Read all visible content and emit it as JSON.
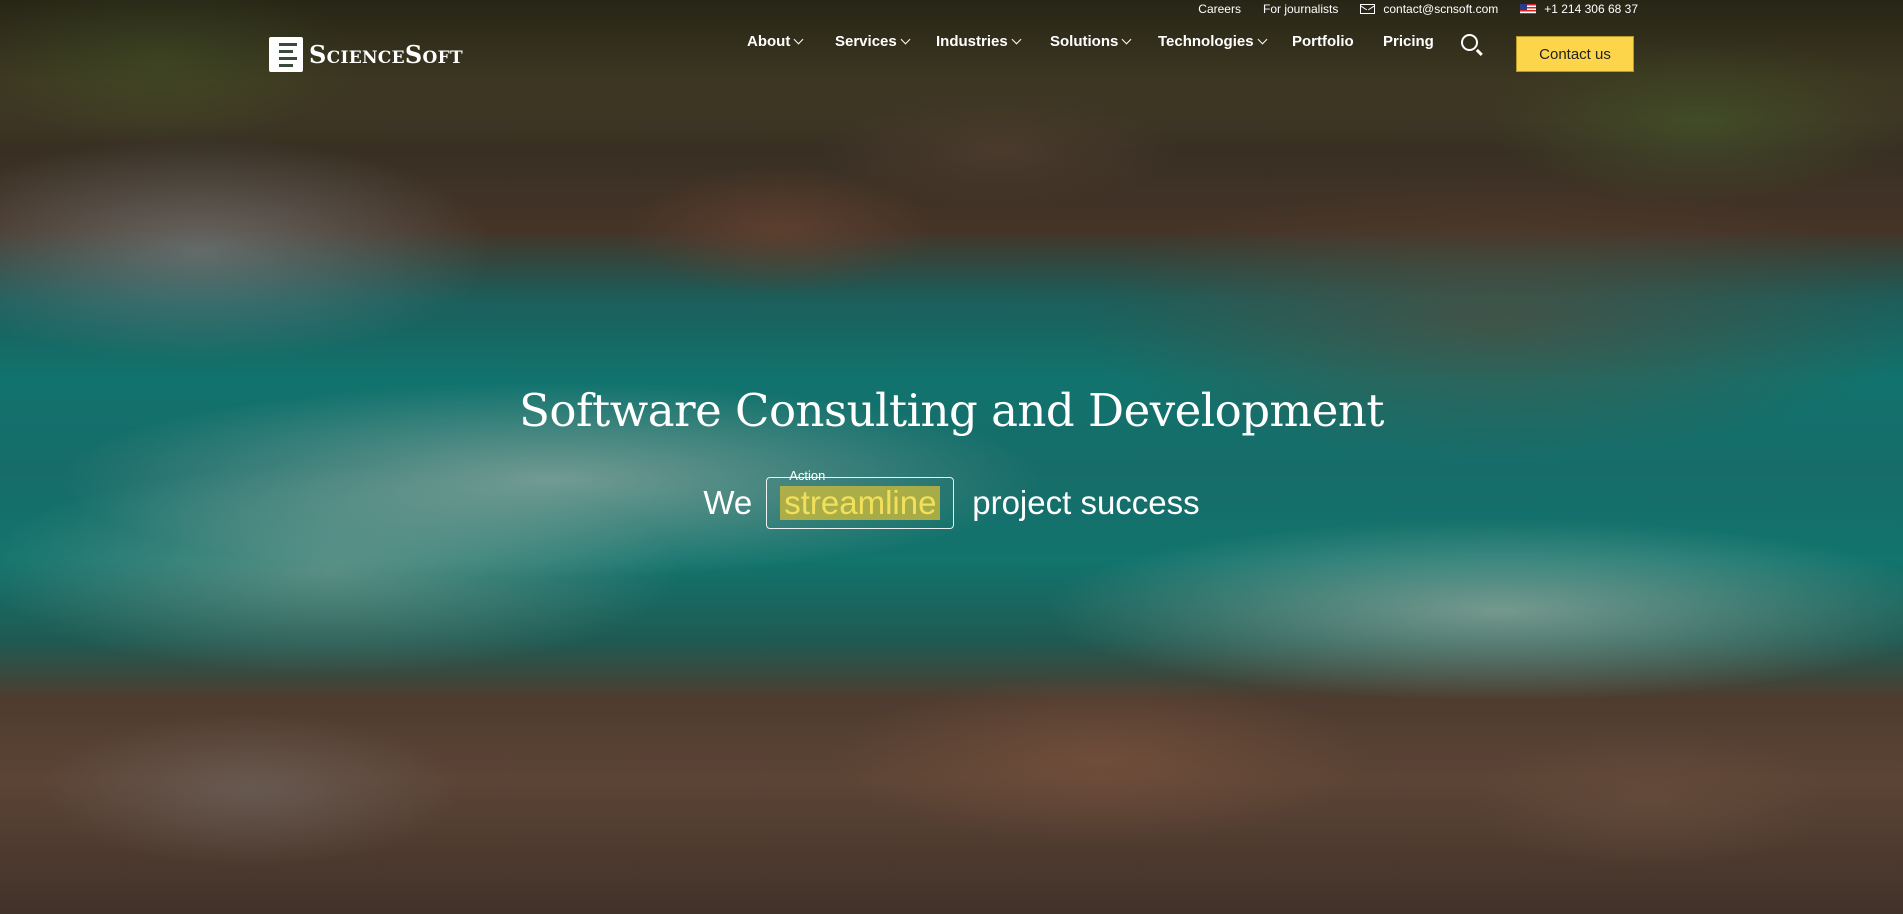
{
  "top_bar": {
    "careers": "Careers",
    "journalists": "For journalists",
    "email": "contact@scnsoft.com",
    "phone": "+1 214 306 68 37"
  },
  "logo": {
    "text": "ScienceSoft"
  },
  "nav": {
    "about": "About",
    "services": "Services",
    "industries": "Industries",
    "solutions": "Solutions",
    "technologies": "Technologies",
    "portfolio": "Portfolio",
    "pricing": "Pricing",
    "contact": "Contact us"
  },
  "hero": {
    "title": "Software Consulting and Development",
    "prefix": "We",
    "action_label": "Action",
    "action_value": "streamline",
    "suffix": "project success"
  },
  "colors": {
    "accent": "#fdd54a",
    "highlight_text": "#f3e05a"
  },
  "icons": [
    "mail-icon",
    "us-flag-icon",
    "search-icon",
    "chevron-down-icon"
  ]
}
